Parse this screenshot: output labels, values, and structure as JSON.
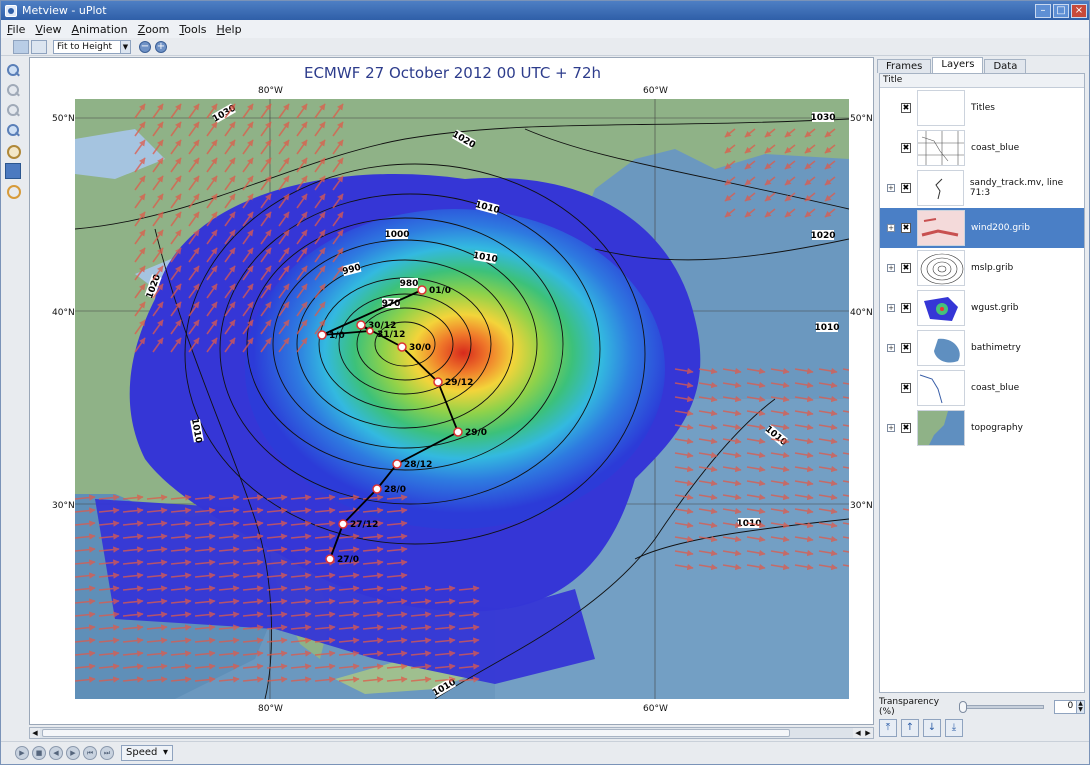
{
  "window": {
    "title": "Metview - uPlot"
  },
  "menu": {
    "items": [
      {
        "mn": "F",
        "rest": "ile"
      },
      {
        "mn": "V",
        "rest": "iew"
      },
      {
        "mn": "A",
        "rest": "nimation"
      },
      {
        "mn": "Z",
        "rest": "oom"
      },
      {
        "mn": "T",
        "rest": "ools"
      },
      {
        "mn": "H",
        "rest": "elp"
      }
    ]
  },
  "toolbar": {
    "fit_mode": "Fit to Height"
  },
  "plot": {
    "title": "ECMWF 27 October 2012 00 UTC + 72h",
    "lon_labels": [
      "80°W",
      "60°W"
    ],
    "lat_labels": [
      "50°N",
      "40°N",
      "30°N"
    ]
  },
  "map": {
    "isobar_labels": [
      "1030",
      "1020",
      "1010",
      "1000",
      "990",
      "980",
      "970",
      "1030",
      "1020",
      "1010",
      "1010",
      "1010",
      "1010",
      "1010",
      "1020",
      "1010"
    ],
    "track": [
      {
        "label": "27/0"
      },
      {
        "label": "27/12"
      },
      {
        "label": "28/0"
      },
      {
        "label": "28/12"
      },
      {
        "label": "29/0"
      },
      {
        "label": "29/12"
      },
      {
        "label": "30/0"
      },
      {
        "label": "30/12"
      },
      {
        "label": "31/12"
      },
      {
        "label": "1/0"
      },
      {
        "label": "01/0"
      }
    ],
    "colors": {
      "land": "#8fb287",
      "ocean": "#5f8fb8",
      "lake": "#a5c4e0",
      "track": "#000000",
      "wind_arrow": "#e05a4a"
    }
  },
  "right_panel": {
    "tabs": [
      "Frames",
      "Layers",
      "Data"
    ],
    "active_tab": "Layers",
    "column_header": "Title",
    "layers": [
      {
        "name": "Titles",
        "icon": "titles-thumb"
      },
      {
        "name": "coast_blue",
        "icon": "coast-grid-thumb"
      },
      {
        "name": "sandy_track.mv, line 71:3",
        "icon": "track-thumb"
      },
      {
        "name": "wind200.grib",
        "icon": "wind-thumb"
      },
      {
        "name": "mslp.grib",
        "icon": "isobar-thumb"
      },
      {
        "name": "wgust.grib",
        "icon": "gust-thumb"
      },
      {
        "name": "bathimetry",
        "icon": "bathymetry-thumb"
      },
      {
        "name": "coast_blue",
        "icon": "coast-thumb"
      },
      {
        "name": "topography",
        "icon": "topography-thumb"
      }
    ],
    "selected_layer": "wind200.grib",
    "transparency_label": "Transparency (%)",
    "transparency_value": "0"
  },
  "animation": {
    "speed_label": "Speed"
  }
}
